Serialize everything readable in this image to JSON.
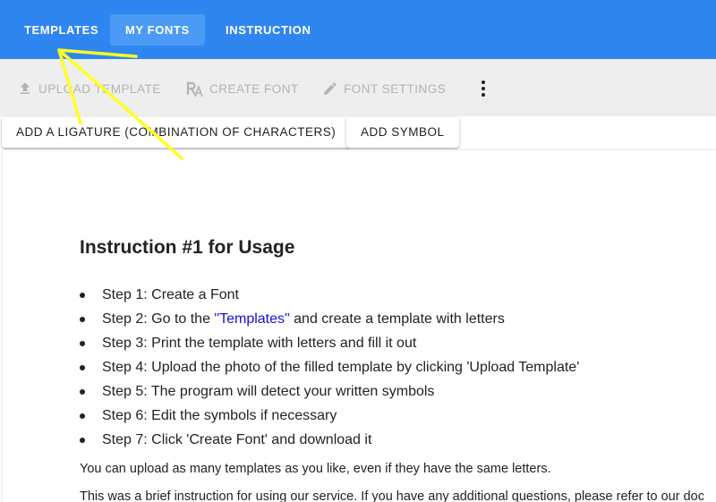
{
  "nav": {
    "tabs": [
      {
        "label": "TEMPLATES"
      },
      {
        "label": "MY FONTS"
      },
      {
        "label": "INSTRUCTION"
      }
    ]
  },
  "toolbar": {
    "upload_label": "UPLOAD TEMPLATE",
    "create_font_label": "CREATE FONT",
    "font_settings_label": "FONT SETTINGS"
  },
  "actions": {
    "add_ligature_label": "ADD A LIGATURE (COMBINATION OF CHARACTERS)",
    "add_symbol_label": "ADD SYMBOL"
  },
  "content": {
    "title": "Instruction #1 for Usage",
    "steps": [
      {
        "text": "Step 1: Create a Font"
      },
      {
        "prefix": "Step 2: Go to the ",
        "link": "\"Templates\"",
        "suffix": " and create a template with letters"
      },
      {
        "text": "Step 3: Print the template with letters and fill it out"
      },
      {
        "text": "Step 4: Upload the photo of the filled template by clicking 'Upload Template'"
      },
      {
        "text": "Step 5: The program will detect your written symbols"
      },
      {
        "text": "Step 6: Edit the symbols if necessary"
      },
      {
        "text": "Step 7: Click 'Create Font' and download it"
      }
    ],
    "note_1": "You can upload as many templates as you like, even if they have the same letters.",
    "note_2": "This was a brief instruction for using our service. If you have any additional questions, please refer to our doc"
  },
  "colors": {
    "nav_bg": "#2f86f0",
    "nav_active_bg": "#4b9bf6",
    "toolbar_bg": "#eeeeee",
    "disabled_text": "#b3b3b3",
    "link": "#1a0dd6",
    "annotation": "#ffff22"
  },
  "icons": {
    "upload": "upload-icon",
    "create_font": "create-font-icon",
    "font_settings": "pencil-icon",
    "more": "more-vertical-icon"
  }
}
